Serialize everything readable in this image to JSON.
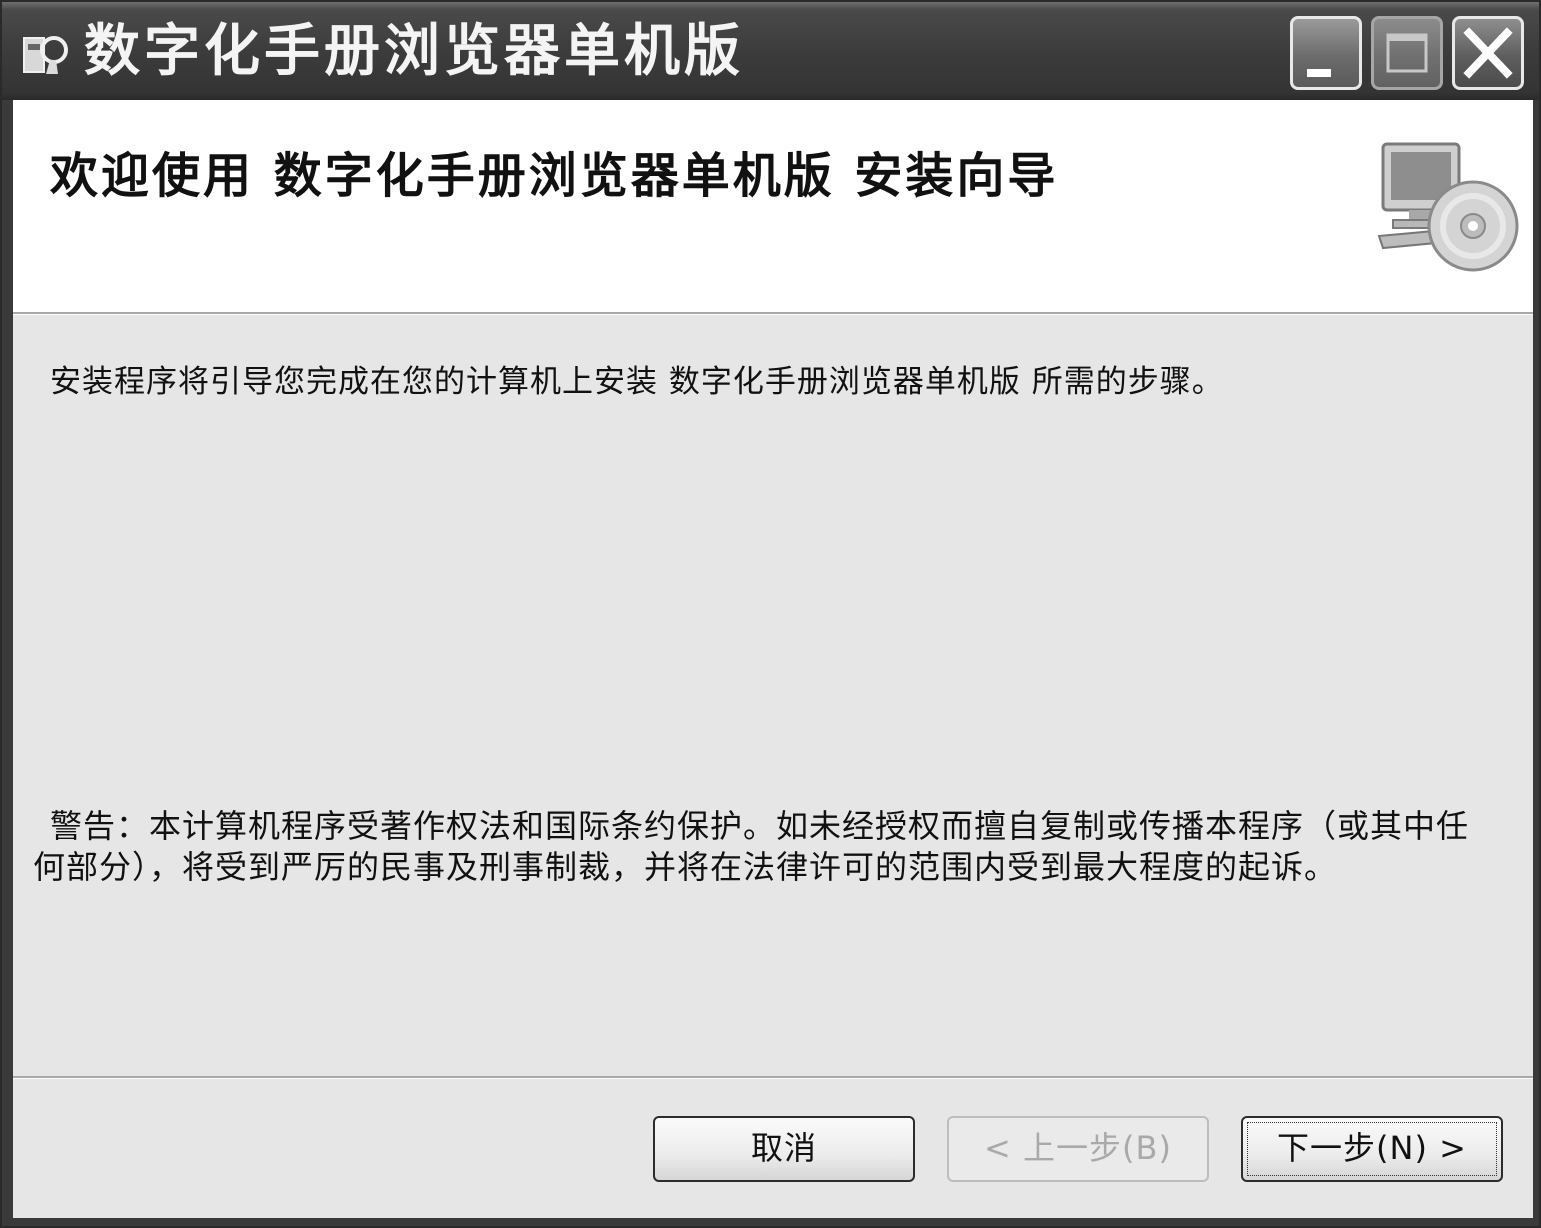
{
  "window": {
    "title": "数字化手册浏览器单机版",
    "icon": "installer-icon",
    "controls": {
      "minimize": "minimize-icon",
      "maximize": "maximize-icon",
      "close": "close-icon"
    }
  },
  "header": {
    "title": "欢迎使用  数字化手册浏览器单机版  安装向导",
    "icon": "computer-cd-icon"
  },
  "body": {
    "intro": "安装程序将引导您完成在您的计算机上安装  数字化手册浏览器单机版  所需的步骤。",
    "warning": "警告：本计算机程序受著作权法和国际条约保护。如未经授权而擅自复制或传播本程序（或其中任何部分），将受到严厉的民事及刑事制裁，并将在法律许可的范围内受到最大程度的起诉。"
  },
  "buttons": {
    "cancel": "取消",
    "back": "< 上一步(B)",
    "next": "下一步(N) >"
  },
  "state": {
    "back_enabled": false,
    "focused_button": "next"
  }
}
